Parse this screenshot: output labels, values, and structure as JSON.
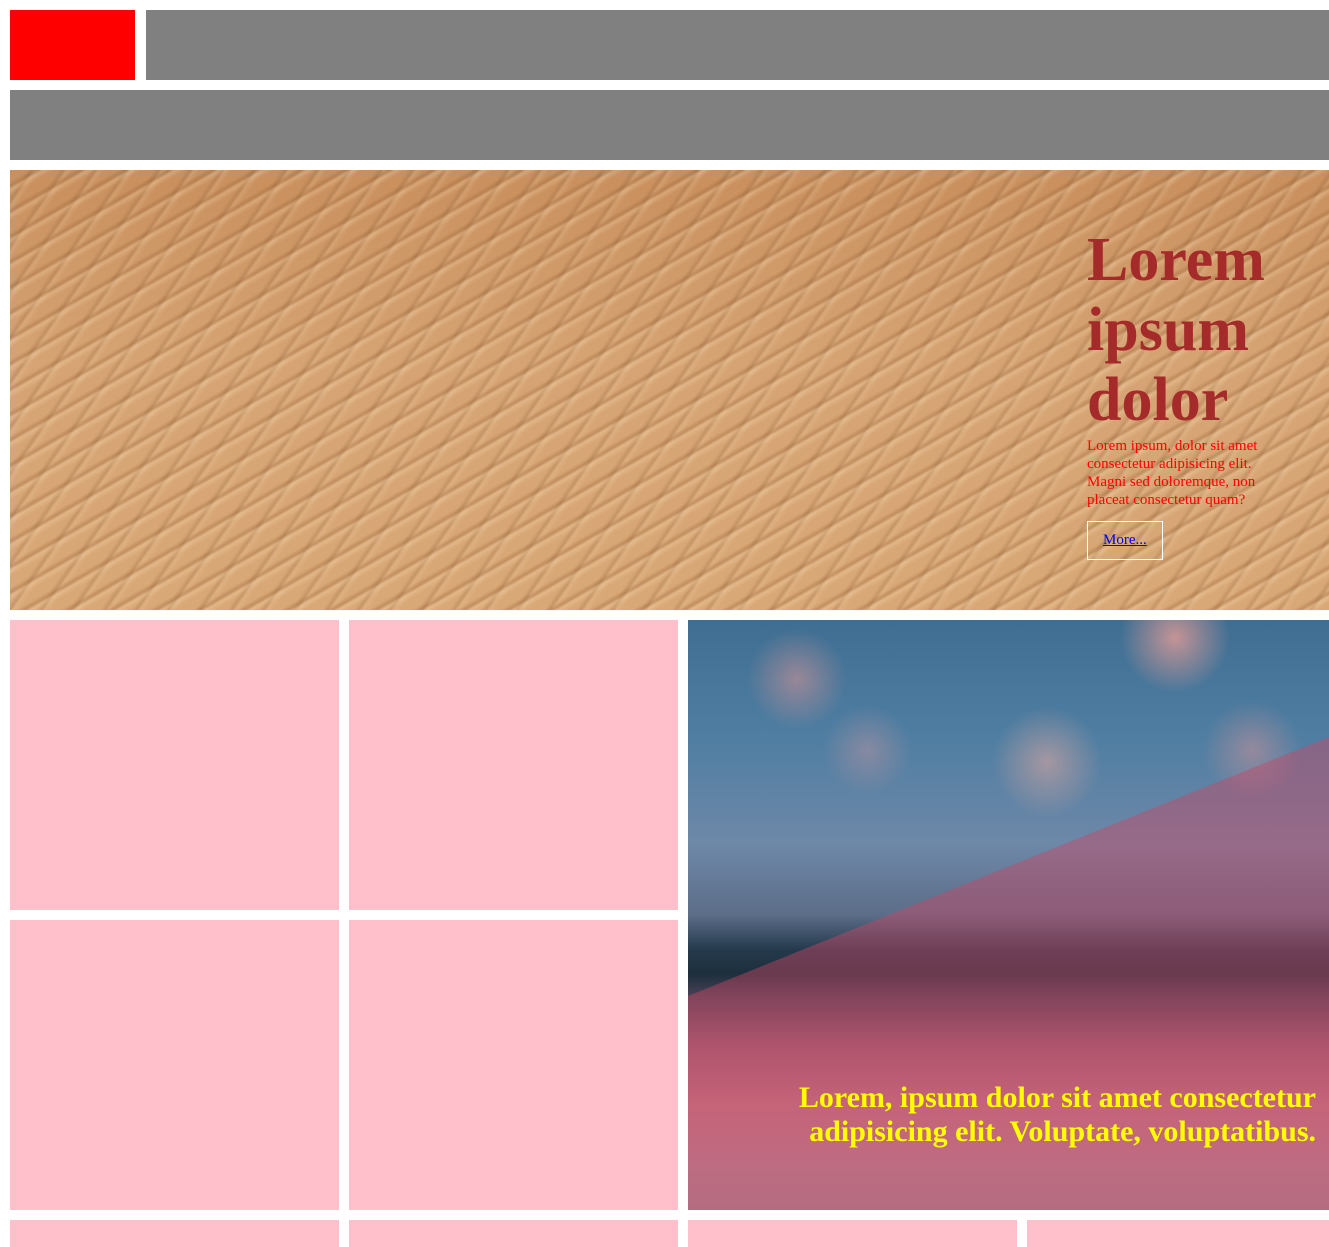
{
  "colors": {
    "logo": "#ff0000",
    "bars": "#808080",
    "tiles": "#ffc0cb",
    "hero_title": "#a52a2a",
    "hero_text": "#ff0000",
    "link": "#0000ee",
    "caption": "#ffff00"
  },
  "hero": {
    "image": "sand-dunes-photo",
    "title": "Lorem ipsum dolor",
    "text": "Lorem ipsum, dolor sit amet consectetur adipisicing elit. Magni sed doloremque, non placeat consectetur quam?",
    "button_label": "More..."
  },
  "feature": {
    "image": "blurred-bokeh-photo",
    "caption": "Lorem, ipsum dolor sit amet consectetur adipisicing elit. Voluptate, voluptatibus."
  }
}
